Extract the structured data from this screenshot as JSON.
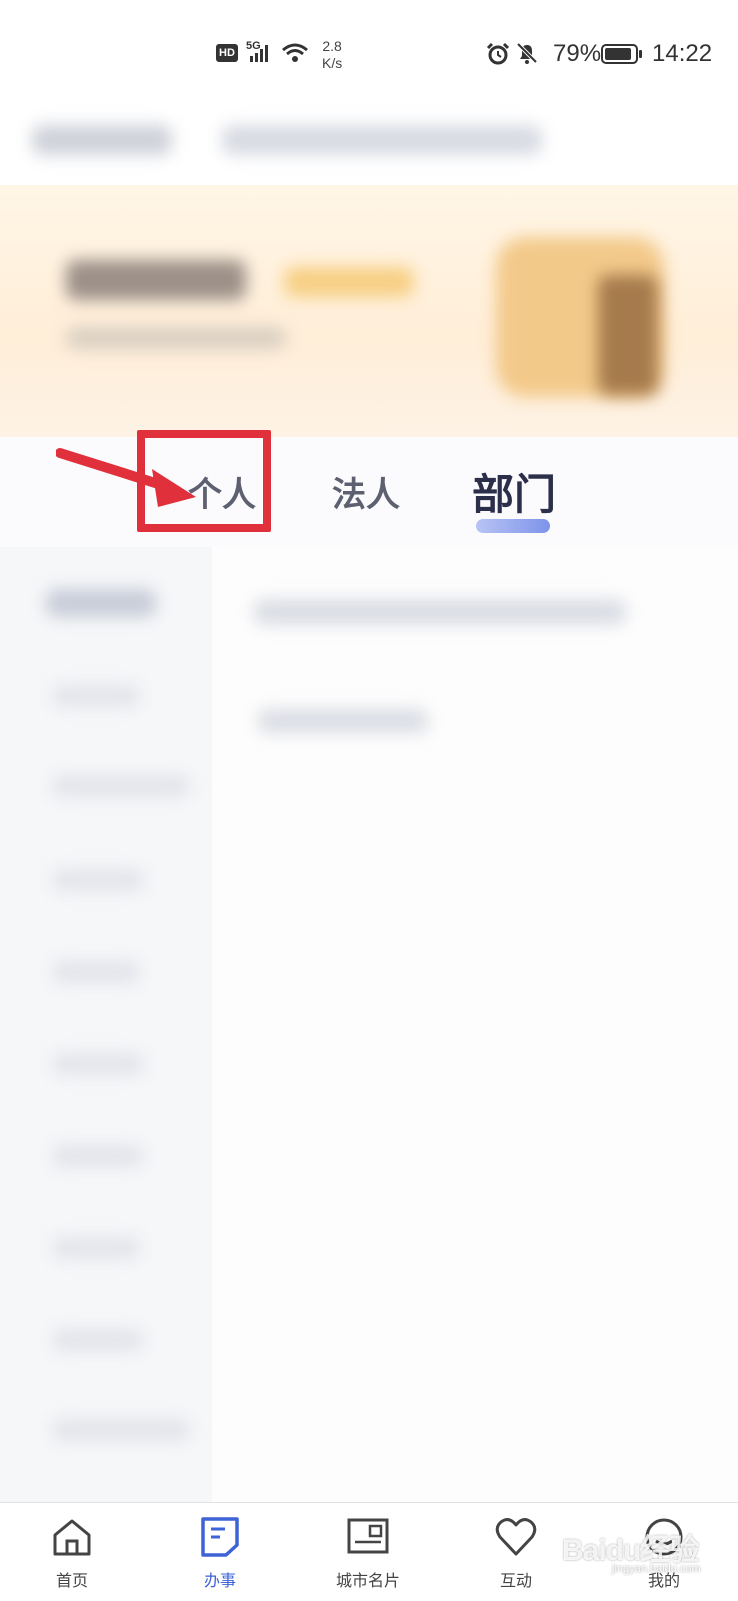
{
  "status_bar": {
    "hd_badge": "HD",
    "network_type": "5G",
    "speed_value": "2.8",
    "speed_unit": "K/s",
    "battery_percent": "79%",
    "time": "14:22"
  },
  "tabs": [
    {
      "label": "个人",
      "selected": false
    },
    {
      "label": "法人",
      "selected": false
    },
    {
      "label": "部门",
      "selected": true
    }
  ],
  "bottom_nav": [
    {
      "label": "首页",
      "icon": "home-icon",
      "active": false
    },
    {
      "label": "办事",
      "icon": "document-icon",
      "active": true
    },
    {
      "label": "城市名片",
      "icon": "city-card-icon",
      "active": false
    },
    {
      "label": "互动",
      "icon": "heart-icon",
      "active": false
    },
    {
      "label": "我的",
      "icon": "profile-icon",
      "active": false
    }
  ],
  "annotation": {
    "highlight_color": "#e0303c"
  },
  "colors": {
    "accent": "#3d63d6",
    "tab_underline": "#7d93ea"
  },
  "watermark": {
    "text": "Baidu经验",
    "sub": "jingyan.baidu.com"
  }
}
